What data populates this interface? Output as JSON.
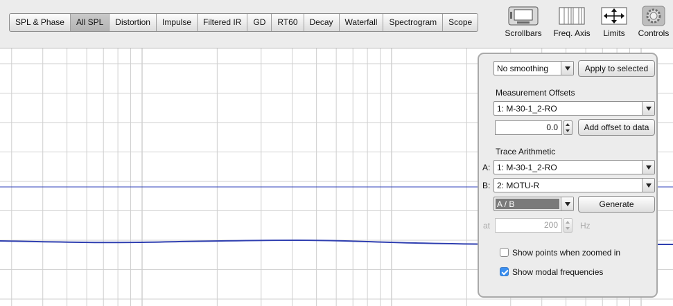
{
  "toolbar": {
    "tabs": [
      {
        "label": "SPL & Phase",
        "active": false
      },
      {
        "label": "All SPL",
        "active": true
      },
      {
        "label": "Distortion",
        "active": false
      },
      {
        "label": "Impulse",
        "active": false
      },
      {
        "label": "Filtered IR",
        "active": false
      },
      {
        "label": "GD",
        "active": false
      },
      {
        "label": "RT60",
        "active": false
      },
      {
        "label": "Decay",
        "active": false
      },
      {
        "label": "Waterfall",
        "active": false
      },
      {
        "label": "Spectrogram",
        "active": false
      },
      {
        "label": "Scope",
        "active": false
      }
    ],
    "tools": [
      {
        "label": "Scrollbars",
        "icon": "scrollbars-icon"
      },
      {
        "label": "Freq. Axis",
        "icon": "freq-axis-icon"
      },
      {
        "label": "Limits",
        "icon": "limits-icon"
      },
      {
        "label": "Controls",
        "icon": "controls-gear-icon"
      }
    ]
  },
  "controls": {
    "smoothing": {
      "value": "No  smoothing"
    },
    "apply_button": "Apply to selected",
    "offsets": {
      "heading": "Measurement Offsets",
      "measurement": "1: M-30-1_2-RO",
      "offset_value": "0.0",
      "add_button": "Add offset to data"
    },
    "arithmetic": {
      "heading": "Trace Arithmetic",
      "a_label": "A:",
      "a_value": "1: M-30-1_2-RO",
      "b_label": "B:",
      "b_value": "2: MOTU-R",
      "operation": "A / B",
      "generate_button": "Generate",
      "at_label": "at",
      "at_value": "200",
      "at_unit": "Hz"
    },
    "show_points": {
      "label": "Show points when zoomed in",
      "checked": false
    },
    "show_modal": {
      "label": "Show modal frequencies",
      "checked": true
    }
  },
  "colors": {
    "trace": "#2f3fb0",
    "reference_line": "#2c3fb8",
    "grid_minor": "#cfcfcf",
    "grid_major": "#b9b9b9"
  }
}
